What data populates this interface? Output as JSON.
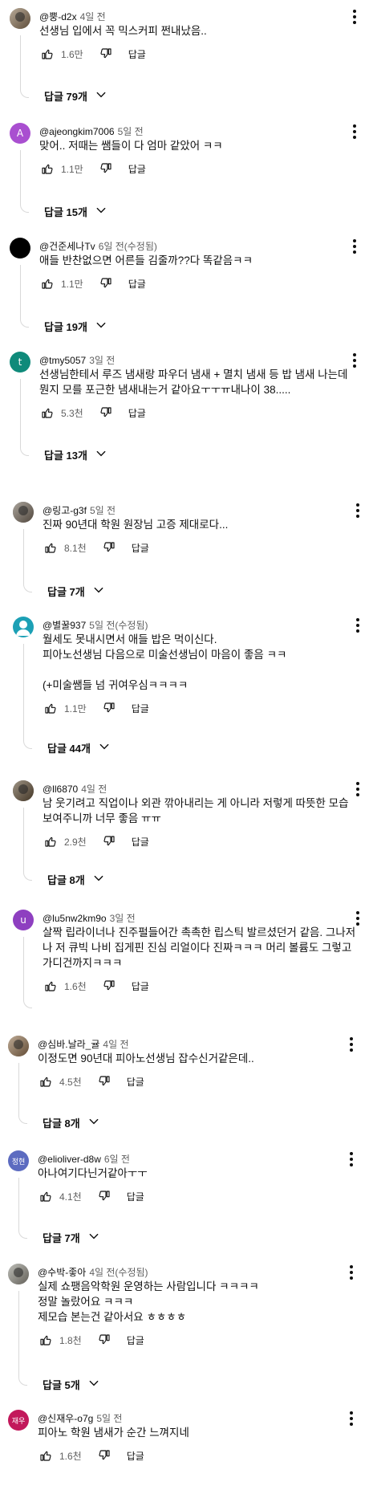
{
  "comments": [
    {
      "author": "@뿡-d2x",
      "time": "4일 전",
      "text": "선생님 입에서 꼭 믹스커피 쩐내났음..",
      "likes": "1.6만",
      "reply": "답글",
      "replies": "답글 79개",
      "avatar": {
        "color": "#7d6a52",
        "letter": "",
        "kind": "photo"
      }
    },
    {
      "author": "@ajeongkim7006",
      "time": "5일 전",
      "text": "맞어.. 저때는 쌤들이 다 엄마 같았어 ㅋㅋ",
      "likes": "1.1만",
      "reply": "답글",
      "replies": "답글 15개",
      "avatar": {
        "color": "#a94fd0",
        "letter": "A",
        "kind": "letter"
      }
    },
    {
      "author": "@건준세나Tv",
      "time": "6일 전(수정됨)",
      "text": "애들 반찬없으면 어른들 김줄까??다 똑같음ㅋㅋ",
      "likes": "1.1만",
      "reply": "답글",
      "replies": "답글 19개",
      "avatar": {
        "color": "#000000",
        "letter": "",
        "kind": "solid"
      }
    },
    {
      "author": "@tmy5057",
      "time": "3일 전",
      "text": "선생님한테서 루즈 냄새랑 파우더 냄새 + 멸치 냄새 등 밥 냄새 나는데\n뭔지 모를 포근한 냄새내는거 같아요ㅜㅜㅠ내나이 38.....",
      "likes": "5.3천",
      "reply": "답글",
      "replies": "답글 13개",
      "avatar": {
        "color": "#0f8a7a",
        "letter": "t",
        "kind": "letter"
      }
    },
    {
      "author": "@링고-g3f",
      "time": "5일 전",
      "text": "진짜 90년대 학원 원장님 고증 제대로다...",
      "likes": "8.1천",
      "reply": "답글",
      "replies": "답글 7개",
      "avatar": {
        "color": "#5a5a5a",
        "letter": "",
        "kind": "photo"
      }
    },
    {
      "author": "@별꿀937",
      "time": "5일 전(수정됨)",
      "text": "월세도 못내시면서 애들 밥은 먹이신다.\n피아노선생님 다음으로 미술선생님이 마음이 좋음 ㅋㅋ\n\n(+미술쌤들 넘 귀여우심ㅋㅋㅋㅋ",
      "likes": "1.1만",
      "reply": "답글",
      "replies": "답글 44개",
      "avatar": {
        "color": "#1ca0b5",
        "letter": "",
        "kind": "person"
      }
    },
    {
      "author": "@ll6870",
      "time": "4일 전",
      "text": "남 웃기려고 직업이나 외관 깎아내리는 게 아니라 저렇게 따뜻한 모습\n보여주니까 너무 좋음 ㅠㅠ",
      "likes": "2.9천",
      "reply": "답글",
      "replies": "답글 8개",
      "avatar": {
        "color": "#3a3020",
        "letter": "",
        "kind": "photo"
      }
    },
    {
      "author": "@lu5nw2km9o",
      "time": "3일 전",
      "text": "살짝 립라이너나 진주펄들어간 촉촉한 립스틱 발르셨던거 같음. 그나저\n나 저 큐빅 나비 집게핀 진심 리얼이다 진짜ㅋㅋㅋ 머리 볼륨도 그렇고\n가디건까지ㅋㅋㅋ",
      "likes": "1.6천",
      "reply": "답글",
      "replies": "",
      "avatar": {
        "color": "#8e3fc0",
        "letter": "u",
        "kind": "letter"
      }
    },
    {
      "author": "@심바.날라_귤",
      "time": "4일 전",
      "text": "이정도면 90년대 피아노선생님 잡수신거같은데..",
      "likes": "4.5천",
      "reply": "답글",
      "replies": "답글 8개",
      "avatar": {
        "color": "#8a6a4a",
        "letter": "",
        "kind": "photo"
      }
    },
    {
      "author": "@elioliver-d8w",
      "time": "6일 전",
      "text": "아나여기다닌거같아ㅜㅜ",
      "likes": "4.1천",
      "reply": "답글",
      "replies": "답글 7개",
      "avatar": {
        "color": "#5c6bc0",
        "letter": "정현",
        "kind": "letter"
      }
    },
    {
      "author": "@수박-좋아",
      "time": "4일 전(수정됨)",
      "text": "실제 쇼팽음악학원 운영하는 사람입니다 ㅋㅋㅋㅋ\n정말 놀랐어요 ㅋㅋㅋ\n제모습 본는건 같아서요 ㅎㅎㅎㅎ",
      "likes": "1.8천",
      "reply": "답글",
      "replies": "답글 5개",
      "avatar": {
        "color": "#8a9aa0",
        "letter": "",
        "kind": "photo"
      }
    },
    {
      "author": "@신재우-o7g",
      "time": "5일 전",
      "text": "피아노 학원 냄새가 순간 느껴지네",
      "likes": "1.6천",
      "reply": "답글",
      "replies": "",
      "avatar": {
        "color": "#c2185b",
        "letter": "재우",
        "kind": "letter"
      }
    }
  ]
}
